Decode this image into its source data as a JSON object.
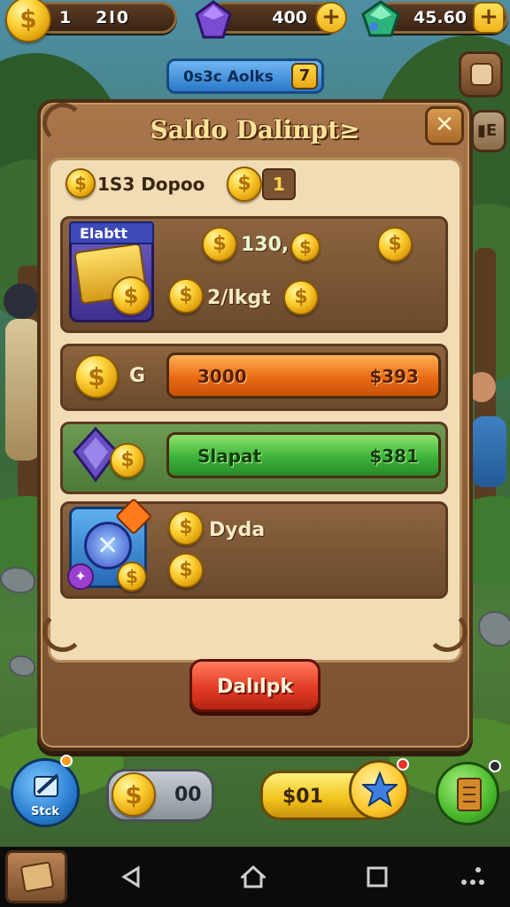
{
  "top_bar": {
    "coins": {
      "value": "1   2l0",
      "icon": "coin-icon"
    },
    "gems": {
      "value": "400",
      "icon": "purple-gem-icon"
    },
    "emeralds": {
      "value": "45.60",
      "icon": "green-gem-icon"
    }
  },
  "tag": {
    "label": "0s3c  Aolks",
    "count": "7"
  },
  "panel": {
    "title": "Saldo Dalinpt≥",
    "close_icon": "close-icon",
    "balance_label": "1S3 Dopoo",
    "balance_count": "1",
    "rows": [
      {
        "badge": "Elabtt",
        "amount": "130,",
        "sub_label": "2/lkgt"
      },
      {
        "label": "G",
        "bar_left": "3000",
        "bar_right": "$393",
        "bar_color": "#ea6a14"
      },
      {
        "bar_left": "Slapat",
        "bar_right": "$381",
        "bar_color": "#3cb33b"
      },
      {
        "label": "Dyda"
      }
    ],
    "action_button": "Dalılpk"
  },
  "bottom_hud": {
    "left_button_label": "Stck",
    "coin_count": "00",
    "price_label": "$01",
    "star_icon": "star-icon",
    "book_icon": "book-icon"
  },
  "colors": {
    "accent": "#ffd43b",
    "panel_brown": "#7a5131",
    "action_red": "#e43c27"
  }
}
